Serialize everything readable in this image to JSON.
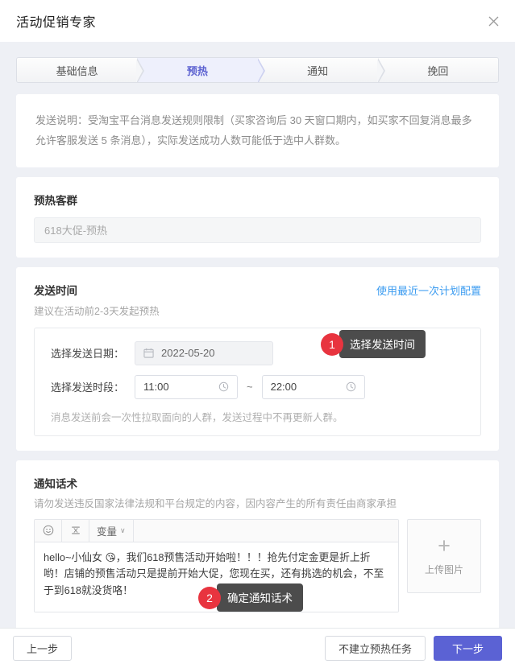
{
  "window": {
    "title": "活动促销专家",
    "close_icon": "close-icon"
  },
  "steps": [
    {
      "label": "基础信息",
      "active": false
    },
    {
      "label": "预热",
      "active": true
    },
    {
      "label": "通知",
      "active": false
    },
    {
      "label": "挽回",
      "active": false
    }
  ],
  "notice": {
    "text": "发送说明：受淘宝平台消息发送规则限制（买家咨询后 30 天窗口期内，如买家不回复消息最多允许客服发送 5 条消息），实际发送成功人数可能低于选中人群数。"
  },
  "crowd": {
    "title": "预热客群",
    "value": "618大促-预热"
  },
  "send_time": {
    "title": "发送时间",
    "config_link": "使用最近一次计划配置",
    "subtitle": "建议在活动前2-3天发起预热",
    "date_label": "选择发送日期：",
    "date_value": "2022-05-20",
    "date_icon": "calendar-icon",
    "range_label": "选择发送时段：",
    "time_start": "11:00",
    "time_end": "22:00",
    "time_icon": "clock-icon",
    "separator": "~",
    "note": "消息发送前会一次性拉取面向的人群，发送过程中不再更新人群。"
  },
  "message": {
    "title": "通知话术",
    "subtitle": "请勿发送违反国家法律法规和平台规定的内容，因内容产生的所有责任由商家承担",
    "toolbar": {
      "emoji_icon": "☺",
      "emoji_name": "emoji-icon",
      "format_icon": "⛌",
      "format_name": "format-icon",
      "variable_label": "变量",
      "variable_chevron": "∨"
    },
    "body": "hello~小仙女 😘，我们618预售活动开始啦！！！抢先付定金更是折上折哟！店铺的预售活动只是提前开始大促，您现在买，还有挑选的机会，不至于到618就没货咯！",
    "upload": {
      "plus": "+",
      "label": "上传图片"
    }
  },
  "callouts": [
    {
      "number": "1",
      "text": "选择发送时间"
    },
    {
      "number": "2",
      "text": "确定通知话术"
    }
  ],
  "footer": {
    "prev": "上一步",
    "skip": "不建立预热任务",
    "next": "下一步"
  },
  "colors": {
    "accent": "#5b62d4",
    "link": "#3a9bf0",
    "badge": "#e8343f",
    "bubble": "#4c4c4c",
    "page_bg": "#eef0f5"
  }
}
